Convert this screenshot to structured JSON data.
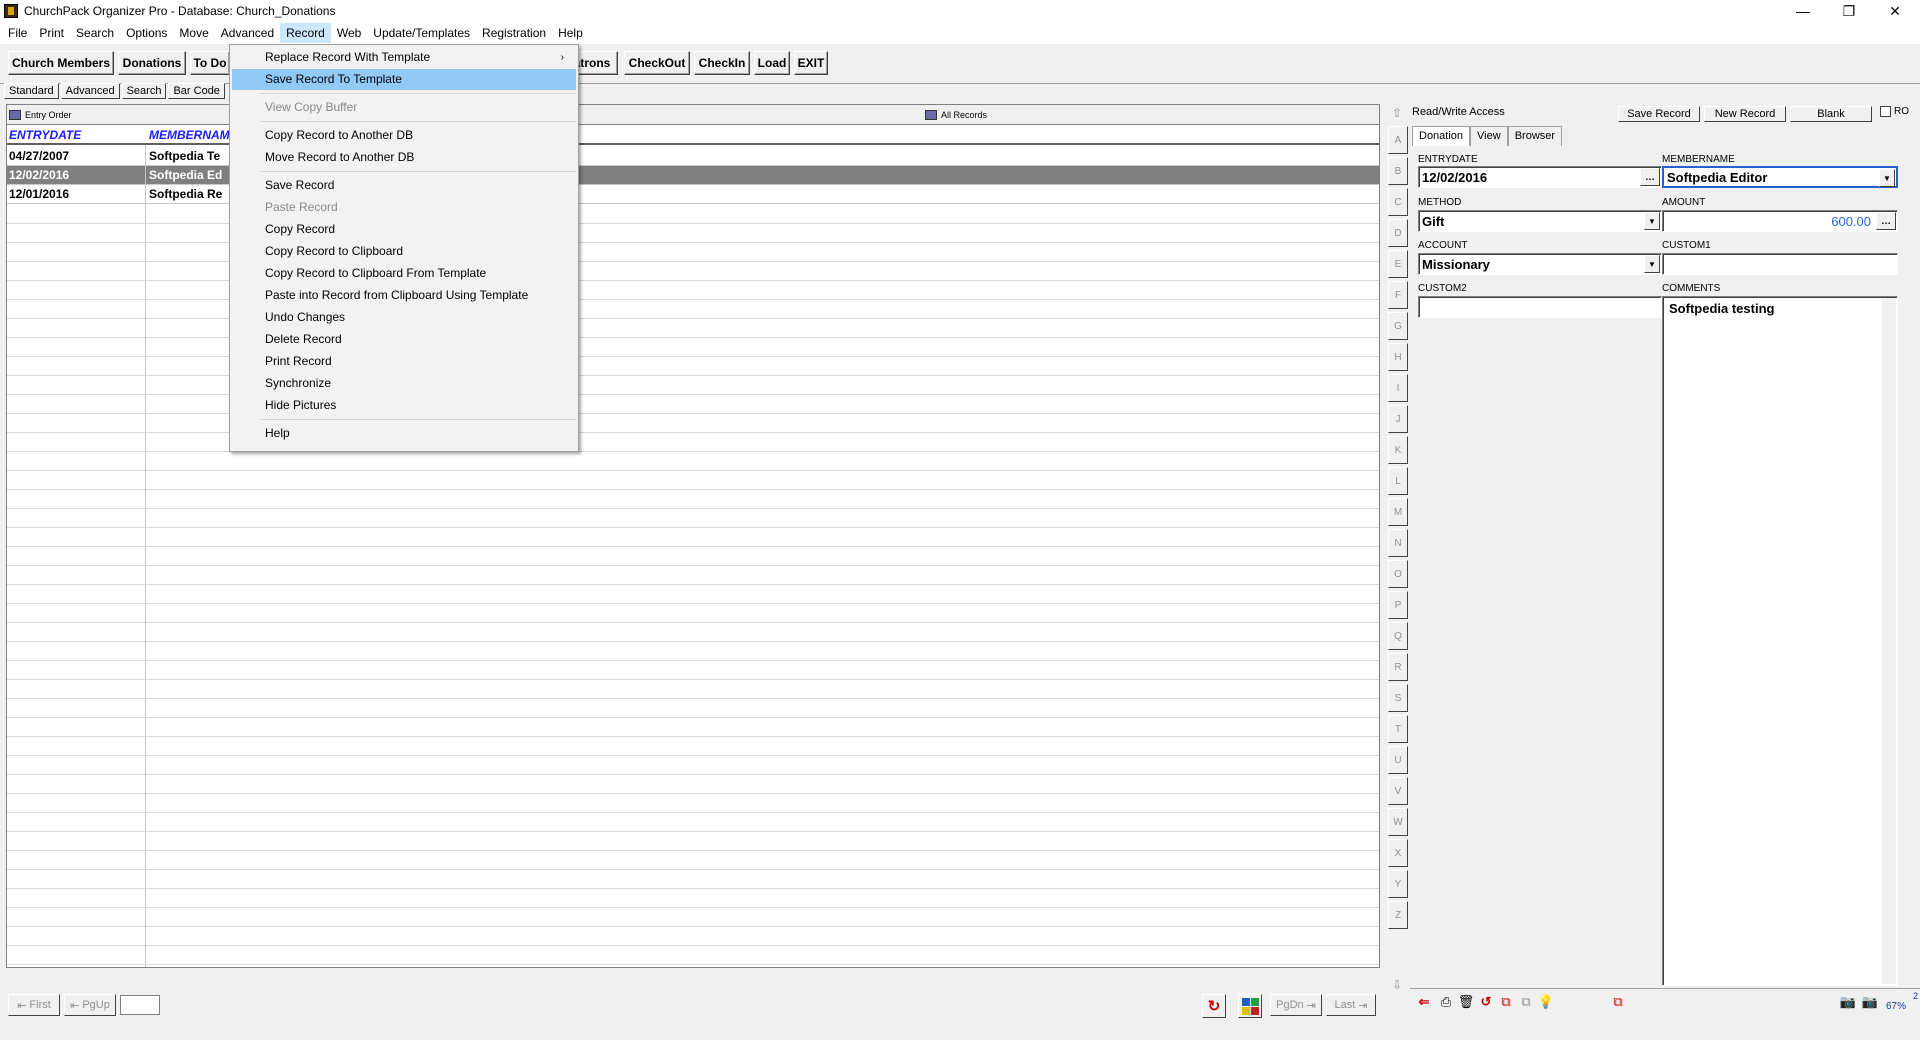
{
  "window": {
    "title": "ChurchPack Organizer Pro - Database: Church_Donations",
    "minimize": "—",
    "maximize": "❐",
    "close": "✕"
  },
  "menubar": [
    "File",
    "Print",
    "Search",
    "Options",
    "Move",
    "Advanced",
    "Record",
    "Web",
    "Update/Templates",
    "Registration",
    "Help"
  ],
  "toolbar": {
    "buttons": [
      "Church Members",
      "Donations",
      "To Do",
      "atrons",
      "CheckOut",
      "CheckIn",
      "Load",
      "EXIT"
    ]
  },
  "view_tabs": [
    "Standard",
    "Advanced",
    "Search",
    "Bar Code"
  ],
  "grid": {
    "sort_label": "Entry Order",
    "filter_label": "All Records",
    "columns": [
      "ENTRYDATE",
      "MEMBERNAM"
    ],
    "rows": [
      {
        "date": "04/27/2007",
        "member": "Softpedia Te"
      },
      {
        "date": "12/02/2016",
        "member": "Softpedia Ed"
      },
      {
        "date": "12/01/2016",
        "member": "Softpedia Re"
      }
    ],
    "selected_row": 1
  },
  "alpha": [
    "A",
    "B",
    "C",
    "D",
    "E",
    "F",
    "G",
    "H",
    "I",
    "J",
    "K",
    "L",
    "M",
    "N",
    "O",
    "P",
    "Q",
    "R",
    "S",
    "T",
    "U",
    "V",
    "W",
    "X",
    "Y",
    "Z"
  ],
  "bottom": {
    "first": "First",
    "pgup": "PgUp",
    "pgdn": "PgDn",
    "last": "Last"
  },
  "record_panel": {
    "access": "Read/Write Access",
    "save": "Save Record",
    "new": "New Record",
    "blank": "Blank",
    "ro": "RO",
    "tabs": [
      "Donation",
      "View",
      "Browser"
    ],
    "fields": {
      "entrydate_label": "ENTRYDATE",
      "entrydate": "12/02/2016",
      "membername_label": "MEMBERNAME",
      "membername": "Softpedia Editor",
      "method_label": "METHOD",
      "method": "Gift",
      "amount_label": "AMOUNT",
      "amount": "600.00",
      "account_label": "ACCOUNT",
      "account": "Missionary",
      "custom1_label": "CUSTOM1",
      "custom1": "",
      "custom2_label": "CUSTOM2",
      "custom2": "",
      "comments_label": "COMMENTS",
      "comments": "Softpedia testing"
    },
    "page_indicator": "2",
    "zoom": "67%"
  },
  "record_menu": {
    "items": [
      {
        "label": "Replace Record With Template",
        "submenu": true
      },
      {
        "label": "Save Record To Template",
        "highlighted": true
      },
      {
        "label": "View Copy Buffer",
        "disabled": true
      },
      {
        "label": "Copy Record to Another DB"
      },
      {
        "label": "Move Record to Another DB"
      },
      {
        "label": "Save Record"
      },
      {
        "label": "Paste Record",
        "disabled": true
      },
      {
        "label": "Copy Record"
      },
      {
        "label": "Copy Record to Clipboard"
      },
      {
        "label": "Copy Record to Clipboard From Template"
      },
      {
        "label": "Paste into Record from Clipboard Using Template"
      },
      {
        "label": "Undo Changes"
      },
      {
        "label": "Delete Record"
      },
      {
        "label": "Print Record"
      },
      {
        "label": "Synchronize"
      },
      {
        "label": "Hide Pictures"
      },
      {
        "label": "Help"
      }
    ],
    "submenu_arrow": "›"
  },
  "colors": {
    "header_text": "#1a1aff",
    "selected_row": "#808080",
    "menu_highlight": "#91c9f7"
  }
}
